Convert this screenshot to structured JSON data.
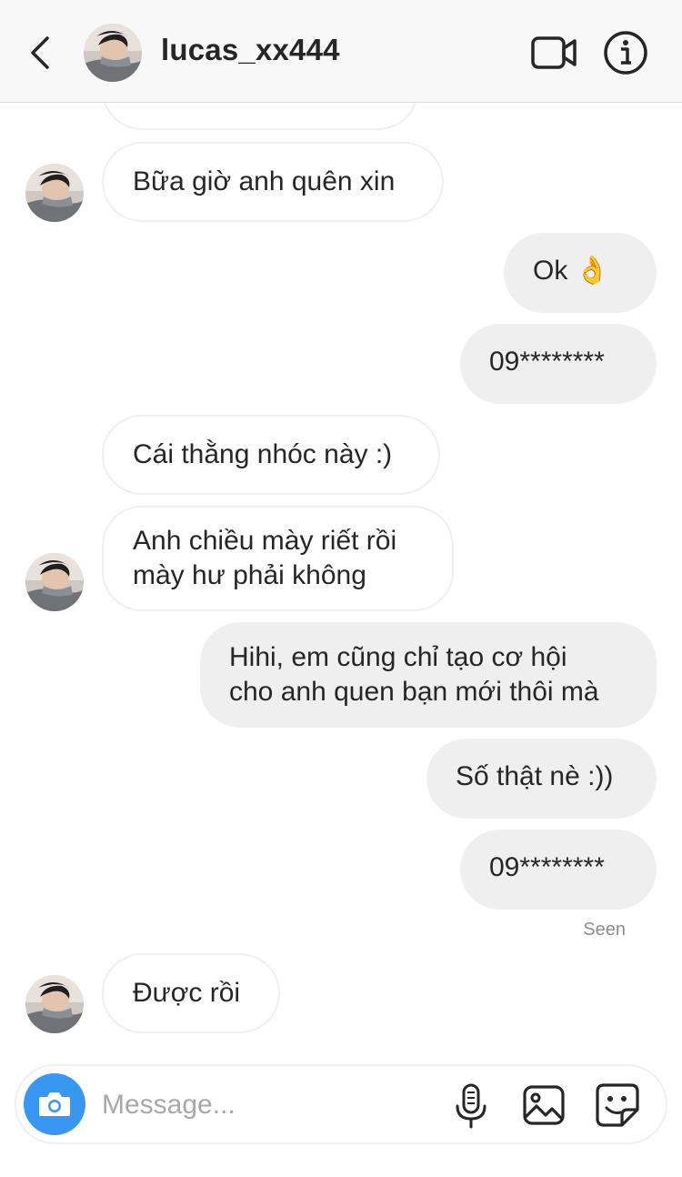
{
  "header": {
    "username": "lucas_xx444"
  },
  "messages": [
    {
      "direction": "in",
      "text": "Bữa giờ anh quên xin"
    },
    {
      "direction": "out",
      "text": "Ok 👌"
    },
    {
      "direction": "out",
      "text": "09********"
    },
    {
      "direction": "in",
      "text": "Cái thằng nhóc này :)"
    },
    {
      "direction": "in",
      "lines": [
        "Anh chiều mày riết rồi",
        "mày hư phải không"
      ]
    },
    {
      "direction": "out",
      "lines": [
        "Hihi, em cũng chỉ tạo cơ hội",
        "cho anh quen bạn mới thôi mà"
      ]
    },
    {
      "direction": "out",
      "text": "Số thật nè :))"
    },
    {
      "direction": "out",
      "text": "09********"
    },
    {
      "direction": "in",
      "text": "Được rồi"
    }
  ],
  "seen_label": "Seen",
  "composer": {
    "placeholder": "Message..."
  },
  "icons": {
    "back": "chevron-left-icon",
    "video": "video-camera-icon",
    "info": "info-icon",
    "camera": "camera-icon",
    "mic": "microphone-icon",
    "gallery": "image-gallery-icon",
    "sticker": "sticker-icon"
  },
  "colors": {
    "camera_button": "#3897f0",
    "outgoing_bubble": "#efefef",
    "incoming_border": "#efefef",
    "header_bg": "#f8f8f8"
  }
}
